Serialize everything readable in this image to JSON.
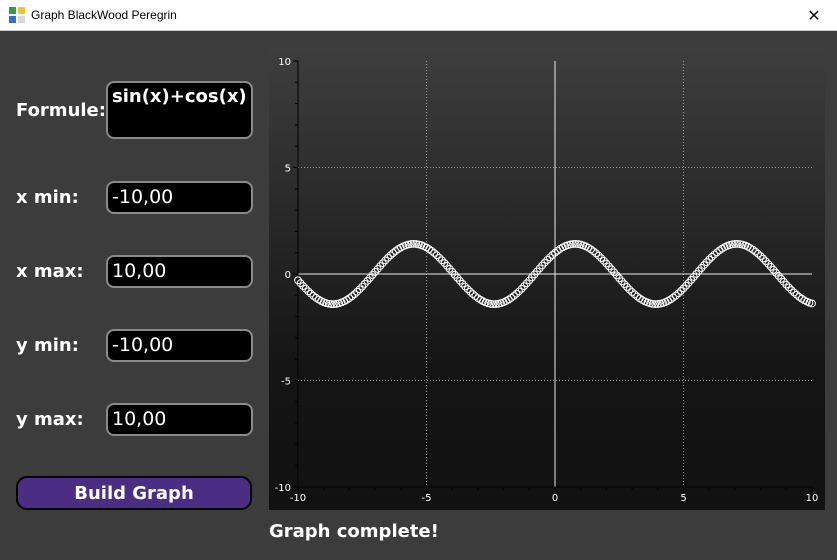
{
  "window": {
    "title": "Graph BlackWood Peregrin",
    "close_glyph": "✕",
    "icon": "app-grid-icon"
  },
  "form": {
    "formula_label": "Formule:",
    "formula_value": "sin(x)+cos(x)",
    "xmin_label": "x min:",
    "xmin_value": "-10,00",
    "xmax_label": "x max:",
    "xmax_value": "10,00",
    "ymin_label": "y min:",
    "ymin_value": "-10,00",
    "ymax_label": "y max:",
    "ymax_value": "10,00",
    "build_label": "Build Graph"
  },
  "status": "Graph complete!",
  "colors": {
    "window_bg": "#3c3c3c",
    "button": "#4b2e83",
    "plot_top": "#3e3e3e",
    "plot_bottom": "#111111"
  },
  "chart_data": {
    "type": "scatter",
    "function": "sin(x)+cos(x)",
    "xlim": [
      -10,
      10
    ],
    "ylim": [
      -10,
      10
    ],
    "x_ticks": [
      "-10",
      "-5",
      "0",
      "5",
      "10"
    ],
    "y_ticks": [
      "10",
      "5",
      "0",
      "-5",
      "-10"
    ],
    "grid": true,
    "marker": "hollow circle",
    "marker_color": "#ffffff"
  }
}
